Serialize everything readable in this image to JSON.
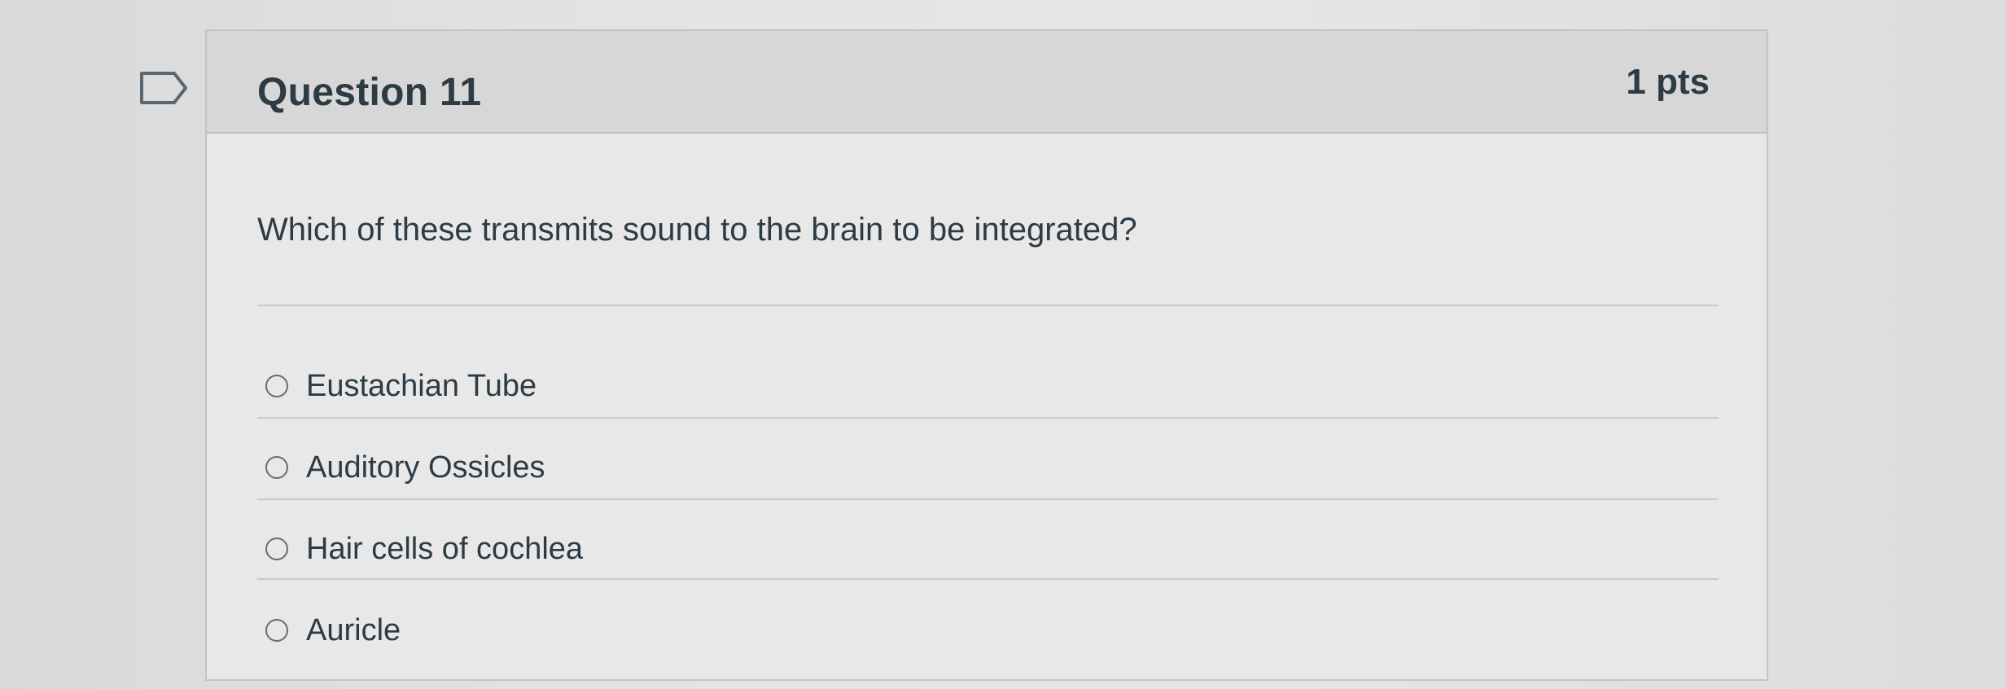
{
  "question": {
    "title": "Question 11",
    "points": "1 pts",
    "text": "Which of these transmits sound to the brain to be integrated?"
  },
  "answers": [
    {
      "label": "Eustachian Tube"
    },
    {
      "label": "Auditory Ossicles"
    },
    {
      "label": "Hair cells of cochlea"
    },
    {
      "label": "Auricle"
    }
  ],
  "icons": {
    "flag": "flag-outline-icon",
    "radio": "radio-unselected-icon"
  },
  "colors": {
    "text": "#2d3b45",
    "header_bg": "#d7d7d7",
    "card_bg": "#e8e8e8",
    "border": "#c4c4c4"
  }
}
